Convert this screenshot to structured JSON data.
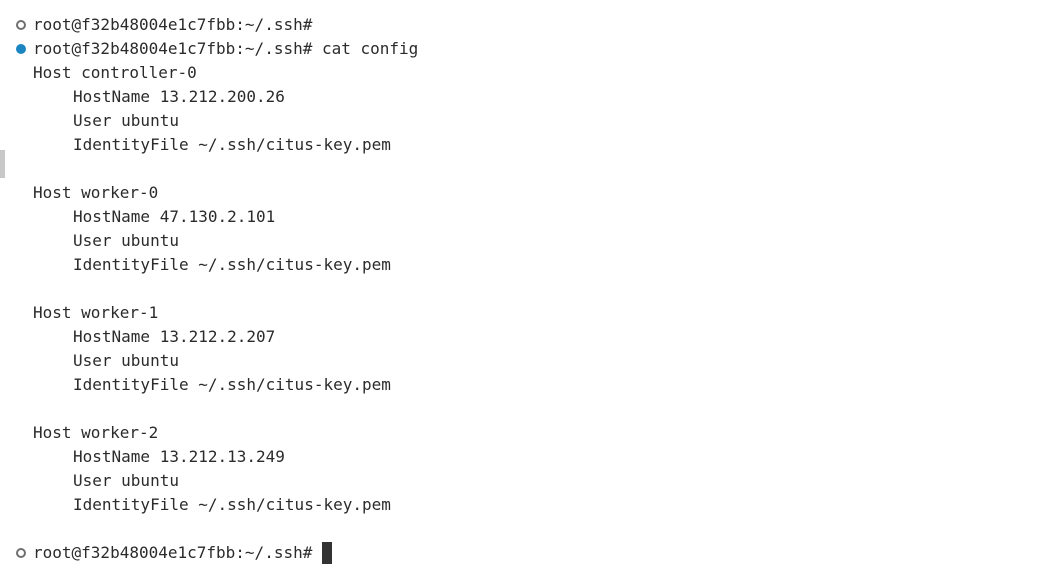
{
  "terminal": {
    "prompt": "root@f32b48004e1c7fbb:~/.ssh#",
    "command": "cat config",
    "lines": [
      {
        "kind": "prompt",
        "deco": "default",
        "text": "root@f32b48004e1c7fbb:~/.ssh#"
      },
      {
        "kind": "prompt",
        "deco": "success",
        "text": "root@f32b48004e1c7fbb:~/.ssh# cat config"
      },
      {
        "kind": "output",
        "indent": false,
        "text": "Host controller-0"
      },
      {
        "kind": "output",
        "indent": true,
        "text": "HostName 13.212.200.26"
      },
      {
        "kind": "output",
        "indent": true,
        "text": "User ubuntu"
      },
      {
        "kind": "output",
        "indent": true,
        "text": "IdentityFile ~/.ssh/citus-key.pem"
      },
      {
        "kind": "output",
        "indent": false,
        "text": ""
      },
      {
        "kind": "output",
        "indent": false,
        "text": "Host worker-0"
      },
      {
        "kind": "output",
        "indent": true,
        "text": "HostName 47.130.2.101"
      },
      {
        "kind": "output",
        "indent": true,
        "text": "User ubuntu"
      },
      {
        "kind": "output",
        "indent": true,
        "text": "IdentityFile ~/.ssh/citus-key.pem"
      },
      {
        "kind": "output",
        "indent": false,
        "text": ""
      },
      {
        "kind": "output",
        "indent": false,
        "text": "Host worker-1"
      },
      {
        "kind": "output",
        "indent": true,
        "text": "HostName 13.212.2.207"
      },
      {
        "kind": "output",
        "indent": true,
        "text": "User ubuntu"
      },
      {
        "kind": "output",
        "indent": true,
        "text": "IdentityFile ~/.ssh/citus-key.pem"
      },
      {
        "kind": "output",
        "indent": false,
        "text": ""
      },
      {
        "kind": "output",
        "indent": false,
        "text": "Host worker-2"
      },
      {
        "kind": "output",
        "indent": true,
        "text": "HostName 13.212.13.249"
      },
      {
        "kind": "output",
        "indent": true,
        "text": "User ubuntu"
      },
      {
        "kind": "output",
        "indent": true,
        "text": "IdentityFile ~/.ssh/citus-key.pem"
      },
      {
        "kind": "output",
        "indent": false,
        "text": ""
      },
      {
        "kind": "prompt",
        "deco": "default",
        "text": "root@f32b48004e1c7fbb:~/.ssh# ",
        "cursor": true
      }
    ]
  },
  "icons": {
    "default_decoration": "command-decoration-default-icon",
    "success_decoration": "command-decoration-success-icon"
  },
  "colors": {
    "background": "#ffffff",
    "foreground": "#2b2b2b",
    "success_decoration": "#1a85c0",
    "default_decoration": "#707070",
    "cursor": "#333333"
  }
}
